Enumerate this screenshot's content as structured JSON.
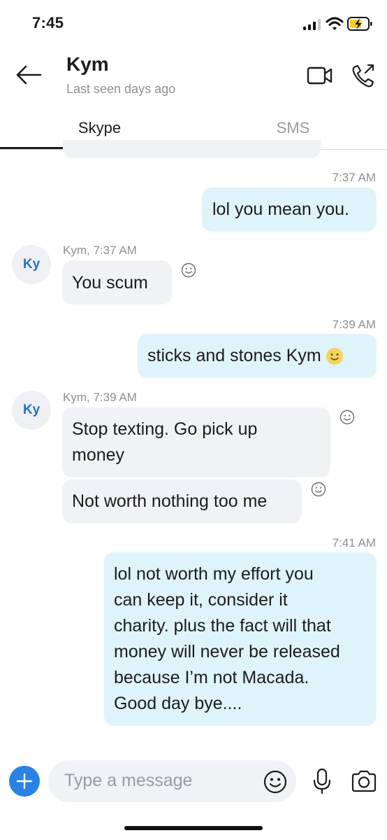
{
  "status_bar": {
    "time": "7:45"
  },
  "header": {
    "contact_name": "Kym",
    "last_seen": "Last seen days ago"
  },
  "tabs": [
    {
      "label": "Skype",
      "active": true
    },
    {
      "label": "SMS",
      "active": false
    }
  ],
  "messages": [
    {
      "direction": "out",
      "timestamp": "7:37 AM",
      "text": "lol you mean you."
    },
    {
      "direction": "in",
      "sender_line": "Kym, 7:37 AM",
      "avatar_initials": "Ky",
      "text": "You scum"
    },
    {
      "direction": "out",
      "timestamp": "7:39 AM",
      "text": "sticks and stones Kym",
      "emoji": "smile-emoji"
    },
    {
      "direction": "in",
      "sender_line": "Kym, 7:39 AM",
      "avatar_initials": "Ky",
      "text_line1": "Stop texting. Go pick up",
      "text_line2": "money"
    },
    {
      "direction": "in",
      "text": "Not worth nothing too me"
    },
    {
      "direction": "out",
      "timestamp": "7:41 AM",
      "lines": [
        "lol not worth my effort you",
        "can keep it, consider it",
        "charity. plus the fact will that",
        "money will never be released",
        "because I’m not Macada.",
        "Good day bye...."
      ]
    }
  ],
  "composer": {
    "placeholder": "Type a message"
  },
  "colors": {
    "outgoing_bubble": "#dff3fb",
    "incoming_bubble": "#f1f2f6",
    "accent_blue": "#2a82e4",
    "avatar_text": "#2570c8"
  },
  "icons": [
    "back-arrow-icon",
    "video-call-icon",
    "phone-call-icon",
    "add-icon",
    "emoji-icon",
    "microphone-icon",
    "camera-icon",
    "reaction-icon"
  ]
}
